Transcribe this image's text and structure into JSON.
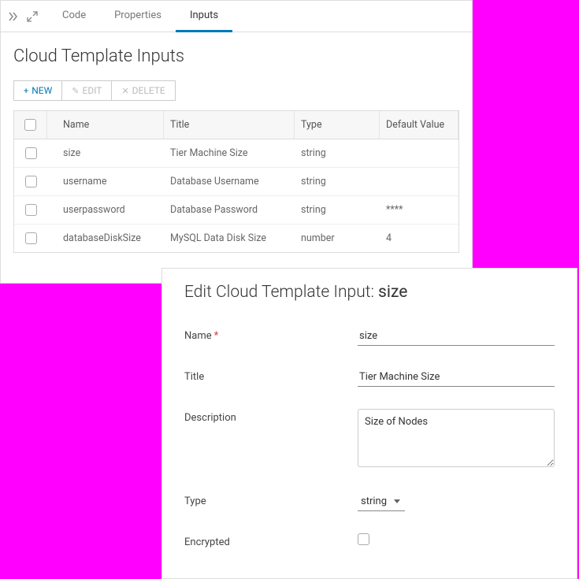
{
  "tabs": {
    "code": "Code",
    "properties": "Properties",
    "inputs": "Inputs"
  },
  "panelTitle": "Cloud Template Inputs",
  "toolbar": {
    "new": "NEW",
    "edit": "EDIT",
    "delete": "DELETE"
  },
  "columns": {
    "name": "Name",
    "title": "Title",
    "type": "Type",
    "default": "Default Value"
  },
  "rows": [
    {
      "name": "size",
      "title": "Tier Machine Size",
      "type": "string",
      "default": ""
    },
    {
      "name": "username",
      "title": "Database Username",
      "type": "string",
      "default": ""
    },
    {
      "name": "userpassword",
      "title": "Database Password",
      "type": "string",
      "default": "****"
    },
    {
      "name": "databaseDiskSize",
      "title": "MySQL Data Disk Size",
      "type": "number",
      "default": "4"
    }
  ],
  "edit": {
    "heading": "Edit Cloud Template Input: ",
    "headingValue": "size",
    "labels": {
      "name": "Name",
      "title": "Title",
      "description": "Description",
      "type": "Type",
      "encrypted": "Encrypted"
    },
    "values": {
      "name": "size",
      "title": "Tier Machine Size",
      "description": "Size of Nodes",
      "type": "string"
    }
  }
}
